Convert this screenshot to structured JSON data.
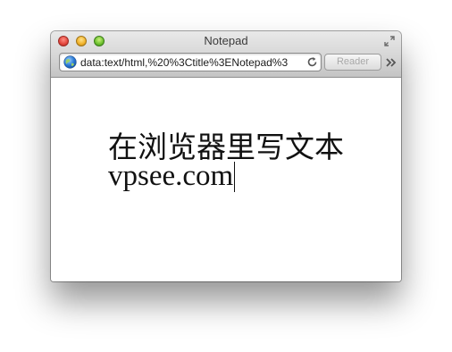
{
  "window": {
    "title": "Notepad"
  },
  "toolbar": {
    "url": "data:text/html,%20%3Ctitle%3ENotepad%3",
    "reader_label": "Reader"
  },
  "document": {
    "line1": "在浏览器里写文本",
    "line2": "vpsee.com"
  },
  "icons": {
    "site": "globe-icon",
    "reload": "reload-icon",
    "fullscreen": "fullscreen-icon",
    "overflow": "double-chevron-icon"
  },
  "colors": {
    "close": "#e2463d",
    "minimize": "#f0b128",
    "maximize": "#6cbf2e"
  }
}
